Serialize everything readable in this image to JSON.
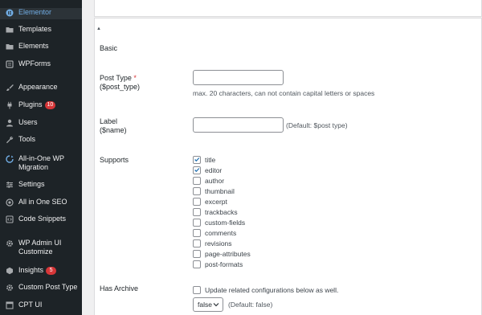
{
  "sidebar": {
    "items": [
      {
        "label": "Elementor",
        "icon": "elementor-icon",
        "active": true
      },
      {
        "label": "Templates",
        "icon": "folder-icon"
      },
      {
        "label": "Elements",
        "icon": "folder-icon"
      },
      {
        "label": "WPForms",
        "icon": "wpforms-icon"
      },
      {
        "label": "Appearance",
        "icon": "paintbrush-icon"
      },
      {
        "label": "Plugins",
        "icon": "plugin-icon",
        "badge": "10"
      },
      {
        "label": "Users",
        "icon": "users-icon"
      },
      {
        "label": "Tools",
        "icon": "wrench-icon"
      },
      {
        "label": "All-in-One WP Migration",
        "icon": "migration-icon"
      },
      {
        "label": "Settings",
        "icon": "settings-icon"
      },
      {
        "label": "All in One SEO",
        "icon": "seo-icon"
      },
      {
        "label": "Code Snippets",
        "icon": "code-icon"
      },
      {
        "label": "WP Admin UI Customize",
        "icon": "gear-icon"
      },
      {
        "label": "Insights",
        "icon": "insights-icon",
        "badge": "5"
      },
      {
        "label": "Custom Post Type",
        "icon": "gear-icon"
      },
      {
        "label": "CPT UI",
        "icon": "cpt-icon"
      }
    ]
  },
  "form": {
    "section_title": "Basic",
    "post_type": {
      "label_line1": "Post Type",
      "required_mark": "*",
      "label_line2": "($post_type)",
      "value": "",
      "description": "max. 20 characters, can not contain capital letters or spaces"
    },
    "label": {
      "label_line1": "Label",
      "label_line2": "($name)",
      "value": "",
      "description": "(Default: $post type)"
    },
    "supports": {
      "label": "Supports",
      "options": [
        {
          "label": "title",
          "checked": true
        },
        {
          "label": "editor",
          "checked": true
        },
        {
          "label": "author",
          "checked": false
        },
        {
          "label": "thumbnail",
          "checked": false
        },
        {
          "label": "excerpt",
          "checked": false
        },
        {
          "label": "trackbacks",
          "checked": false
        },
        {
          "label": "custom-fields",
          "checked": false
        },
        {
          "label": "comments",
          "checked": false
        },
        {
          "label": "revisions",
          "checked": false
        },
        {
          "label": "page-attributes",
          "checked": false
        },
        {
          "label": "post-formats",
          "checked": false
        }
      ]
    },
    "has_archive": {
      "label": "Has Archive",
      "checkbox_label": "Update related configurations below as well.",
      "checked": false,
      "select_value": "false",
      "select_description": "(Default: false)"
    }
  },
  "colors": {
    "sidebar_bg": "#1d2327",
    "active_text": "#72aee6",
    "badge": "#d63638",
    "required": "#d63638"
  }
}
